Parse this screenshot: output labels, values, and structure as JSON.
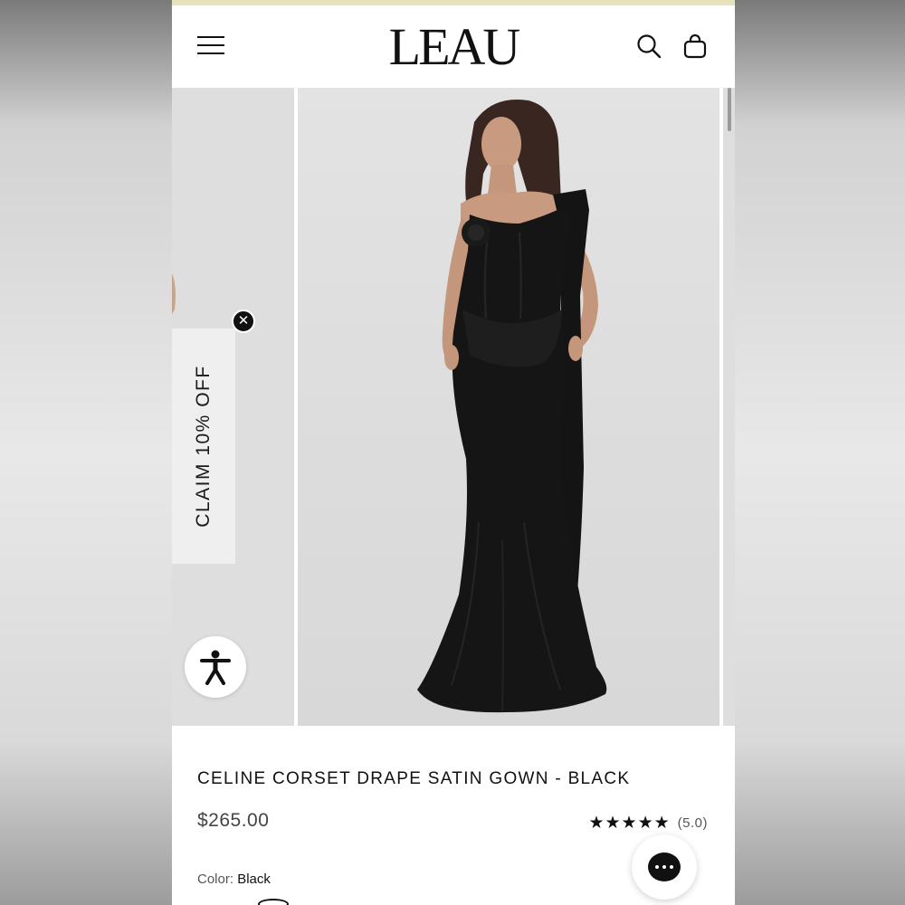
{
  "header": {
    "logo": "LEAU",
    "menu_icon": "hamburger-menu-icon",
    "search_icon": "search-icon",
    "bag_icon": "shopping-bag-icon"
  },
  "gallery": {
    "zoom_icon": "zoom-in-icon",
    "image_alt": "Model wearing black corset drape satin gown"
  },
  "promo": {
    "label": "CLAIM 10% OFF",
    "close_label": "✕"
  },
  "accessibility": {
    "icon": "accessibility-icon"
  },
  "product": {
    "title": "CELINE CORSET DRAPE SATIN GOWN - BLACK",
    "price": "$265.00",
    "stars": "★★★★★",
    "rating": "(5.0)",
    "color_label": "Color:",
    "color_value": "Black"
  },
  "chat": {
    "icon": "chat-bubble-icon"
  },
  "colors": {
    "accent_strip": "#e6e3b8",
    "text": "#111111",
    "price": "#444444"
  }
}
